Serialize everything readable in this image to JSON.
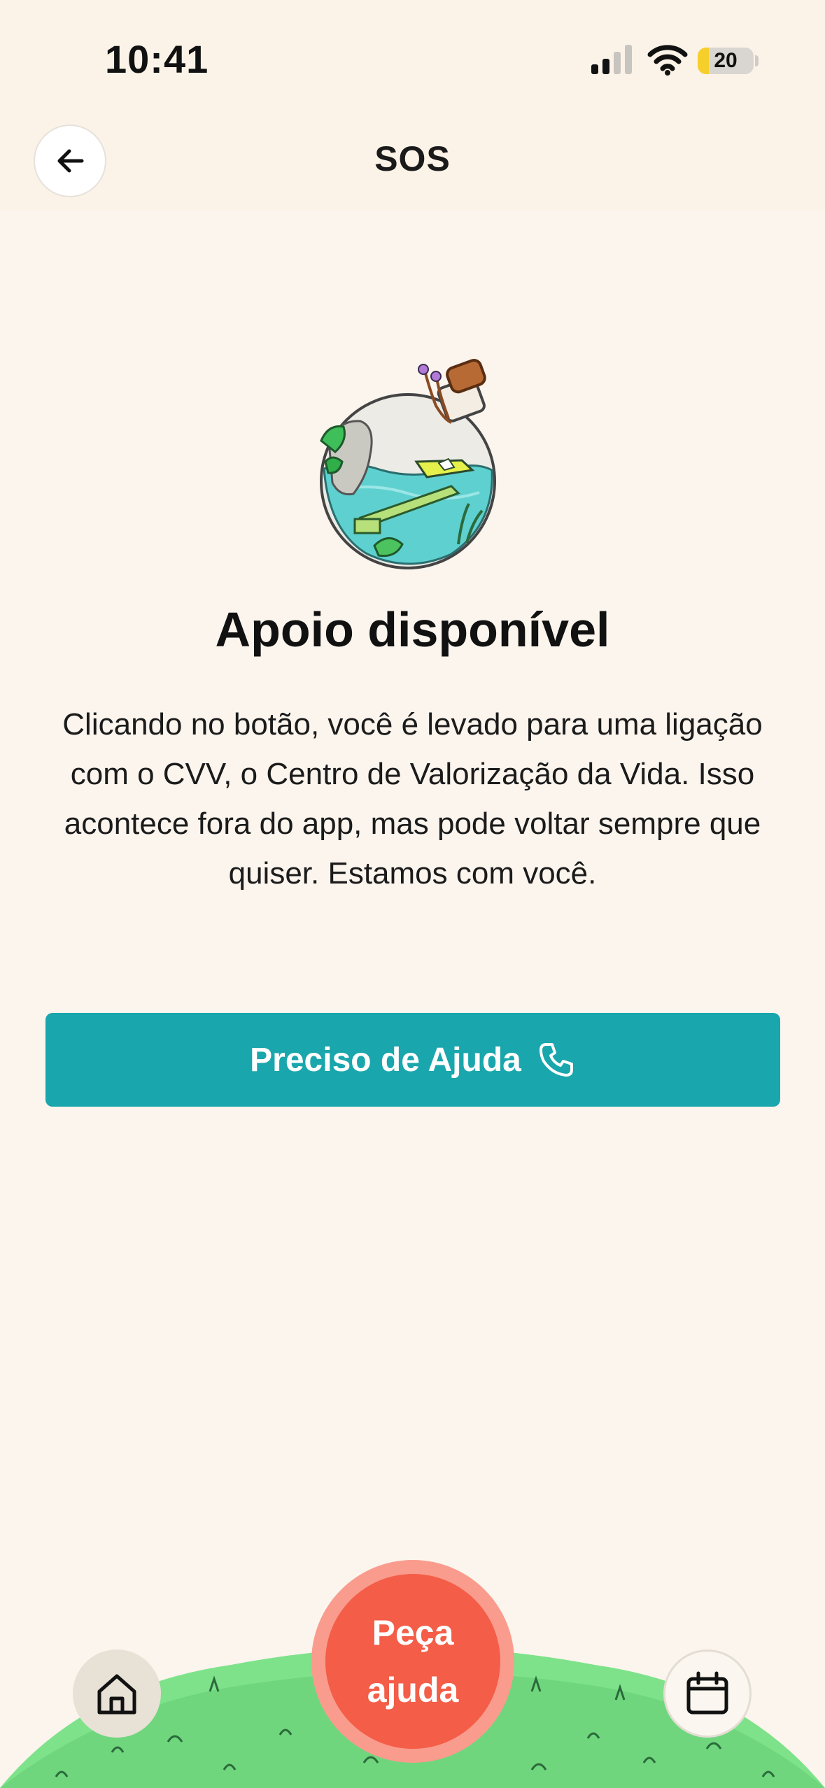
{
  "status_bar": {
    "time": "10:41",
    "battery_level": "20",
    "battery_fraction": 0.2,
    "signal_bars_active": 2,
    "signal_bars_total": 4,
    "battery_color": "#f7cf2b"
  },
  "header": {
    "title": "SOS",
    "back_icon": "arrow-left-icon"
  },
  "main": {
    "illustration": "bottle-illustration",
    "heading": "Apoio disponível",
    "description": "Clicando no botão, você é levado para uma ligação com o CVV, o Centro de Valorização da Vida. Isso acontece fora do app, mas pode voltar sempre que quiser. Estamos com você.",
    "help_button": {
      "label": "Preciso de Ajuda",
      "icon": "phone-icon",
      "color": "#19a6ac"
    }
  },
  "tab_bar": {
    "home_icon": "home-icon",
    "calendar_icon": "calendar-icon",
    "sos_button": {
      "line1": "Peça",
      "line2": "ajuda",
      "color": "#f45d47"
    }
  }
}
